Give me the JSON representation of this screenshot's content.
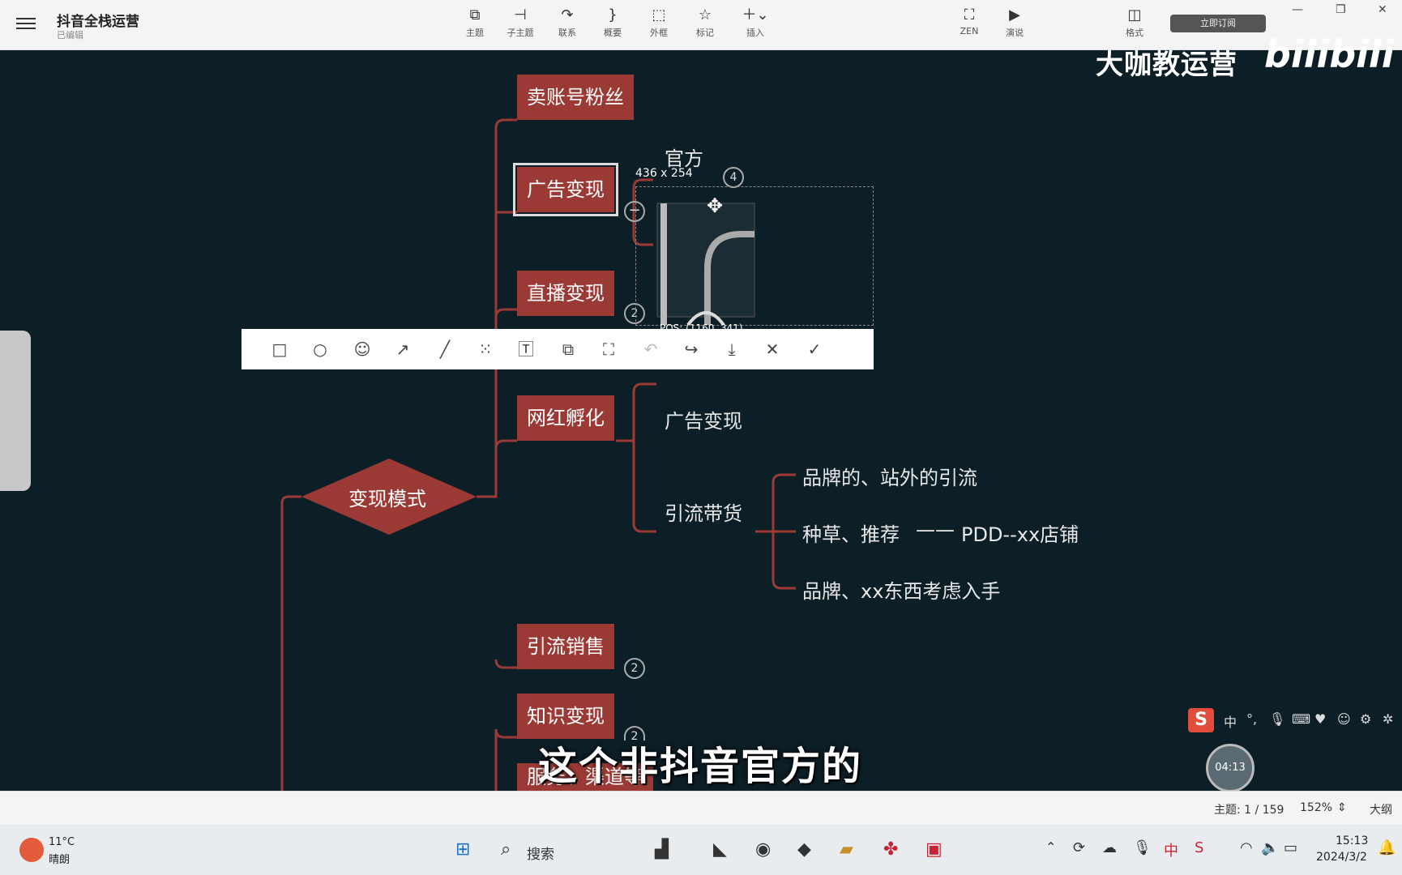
{
  "app": {
    "title": "抖音全栈运营",
    "status": "已编辑"
  },
  "toolbar": {
    "items": [
      {
        "label": "主题",
        "icon": "topic-icon"
      },
      {
        "label": "子主题",
        "icon": "subtopic-icon"
      },
      {
        "label": "联系",
        "icon": "relation-icon"
      },
      {
        "label": "概要",
        "icon": "summary-icon"
      },
      {
        "label": "外框",
        "icon": "boundary-icon"
      },
      {
        "label": "标记",
        "icon": "marker-icon"
      },
      {
        "label": "插入",
        "icon": "insert-icon"
      },
      {
        "label": "ZEN",
        "icon": "zen-icon"
      },
      {
        "label": "演说",
        "icon": "pitch-icon"
      },
      {
        "label": "格式",
        "icon": "format-icon"
      }
    ],
    "subscribe": "立即订阅"
  },
  "watermark": {
    "channel": "大咖教运营",
    "site": "bilibili"
  },
  "mindmap": {
    "root": "变现模式",
    "branches": [
      "卖账号粉丝",
      "广告变现",
      "直播变现",
      "网红孵化",
      "引流销售",
      "知识变现",
      "服务、渠道等"
    ],
    "badges": {
      "guanggao": "4",
      "zhibo": "2",
      "yinliu": "2",
      "zhishi": "2"
    },
    "sub_official": "官方",
    "wanghong_children": [
      "广告变现",
      "引流带货"
    ],
    "yinliu_children": [
      "品牌的、站外的引流",
      "种草、推荐",
      "品牌、xx东西考虑入手"
    ],
    "pdd_note": "PDD--xx店铺",
    "connector": "——"
  },
  "capture": {
    "size": "436 x 254",
    "pos": "POS: (1160, 341)"
  },
  "snip_tools": [
    "rectangle-icon",
    "ellipse-icon",
    "emoji-icon",
    "arrow-icon",
    "pen-icon",
    "mosaic-icon",
    "text-icon",
    "pin-icon",
    "ocr-icon",
    "undo-icon",
    "share-icon",
    "save-icon",
    "close-icon",
    "confirm-icon"
  ],
  "subtitle": "这个非抖音官方的",
  "ime": {
    "logo": "S",
    "mode": "中",
    "punct": "°,"
  },
  "timer": "04:13",
  "statusbar": {
    "topic_count": "主题: 1 / 159",
    "zoom": "152%",
    "outline": "大纲"
  },
  "taskbar": {
    "weather_temp": "11°C",
    "weather_desc": "晴朗",
    "search": "搜索",
    "time": "15:13",
    "date": "2024/3/2"
  }
}
